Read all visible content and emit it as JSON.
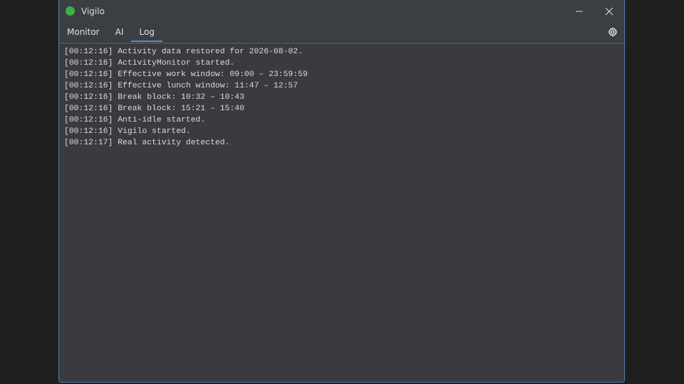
{
  "window": {
    "title": "Vigilo",
    "status_color": "#3cb04a",
    "accent_color": "#5b8dc9"
  },
  "controls": {
    "minimize_icon": "minimize-icon",
    "close_icon": "close-icon"
  },
  "tabs": [
    {
      "label": "Monitor",
      "active": false
    },
    {
      "label": "AI",
      "active": false
    },
    {
      "label": "Log",
      "active": true
    }
  ],
  "settings_icon": "gear-icon",
  "log": {
    "lines": [
      "[00:12:16] Activity data restored for 2026-08-02.",
      "[00:12:16] ActivityMonitor started.",
      "[00:12:16] Effective work window: 09:00 – 23:59:59",
      "[00:12:16] Effective lunch window: 11:47 – 12:57",
      "[00:12:16] Break block: 10:32 – 10:43",
      "[00:12:16] Break block: 15:21 – 15:40",
      "[00:12:16] Anti-idle started.",
      "[00:12:16] Vigilo started.",
      "[00:12:17] Real activity detected."
    ]
  }
}
